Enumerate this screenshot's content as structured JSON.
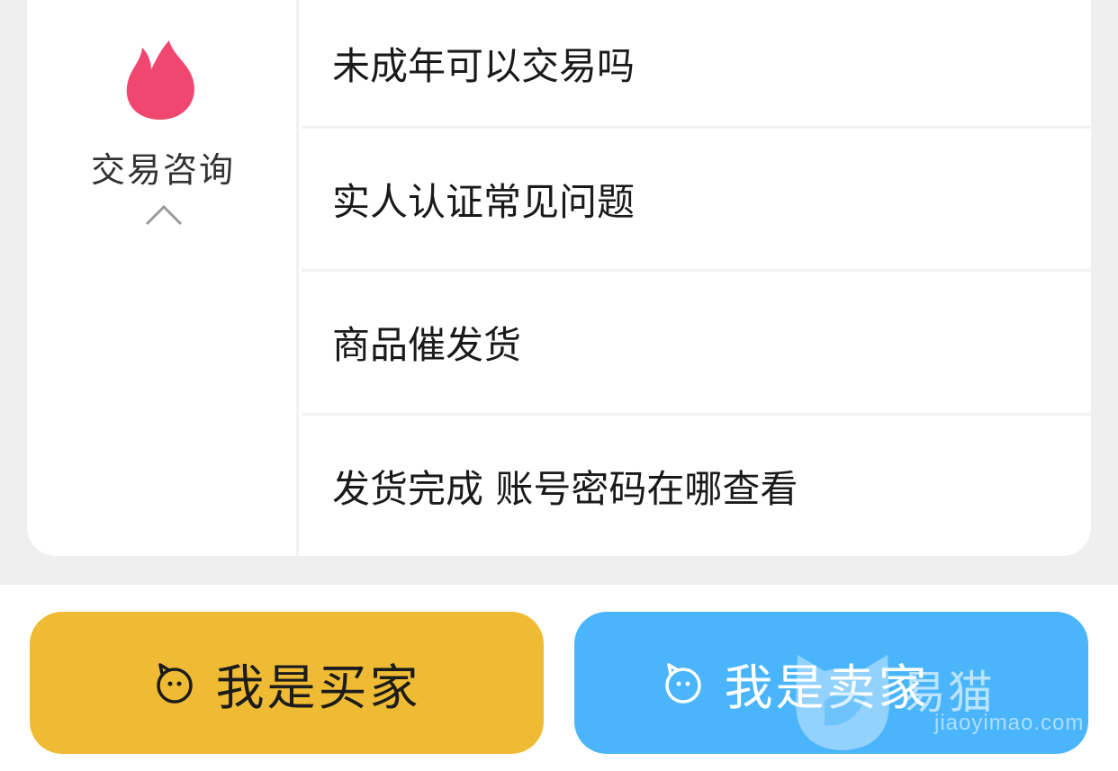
{
  "category": {
    "icon": "flame-icon",
    "label": "交易咨询",
    "toggle_icon": "chevron-up-icon",
    "icon_color": "#ef4770"
  },
  "faq": {
    "items": [
      {
        "label": "未成年可以交易吗"
      },
      {
        "label": "实人认证常见问题"
      },
      {
        "label": "商品催发货"
      },
      {
        "label": "发货完成 账号密码在哪查看"
      }
    ]
  },
  "actions": {
    "buyer": {
      "label": "我是买家",
      "icon": "face-icon",
      "color": "#f0bb34"
    },
    "seller": {
      "label": "我是卖家",
      "icon": "face-icon",
      "color": "#4ab5fb"
    }
  },
  "watermark": {
    "brand": "易猫",
    "domain": "jiaoyimao.com",
    "icon": "cat-head-icon"
  }
}
